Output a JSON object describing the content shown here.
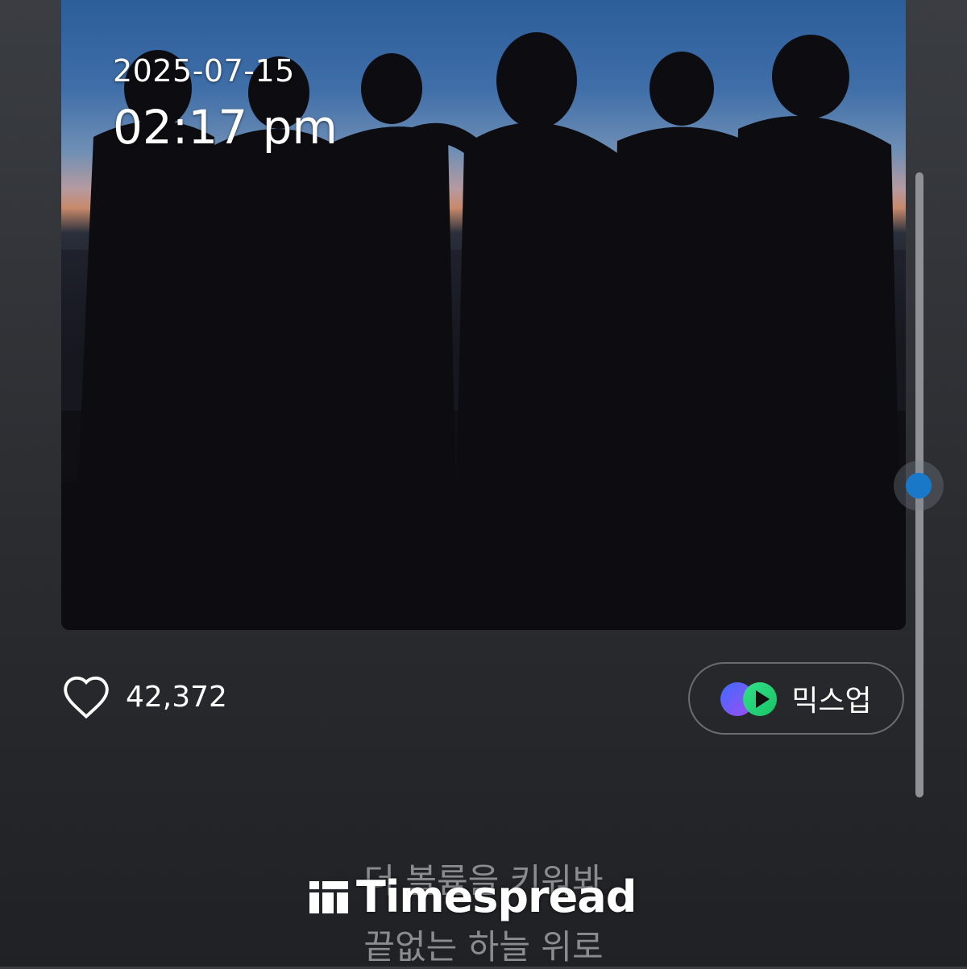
{
  "album": {
    "date": "2025-07-15",
    "time": "02:17 pm"
  },
  "scrollbar": {
    "position": 0.5
  },
  "likes": {
    "count": "42,372",
    "icon": "heart-outline-icon"
  },
  "mixup": {
    "label": "믹스업",
    "icon": "mixup-icon",
    "colors": {
      "left": "#6a5cff",
      "right": "#22d37a"
    }
  },
  "lyrics": {
    "line1": "더 볼륨을 키워봐",
    "line2": "끝없는 하늘 위로"
  },
  "watermark": {
    "brand": "Timespread"
  }
}
